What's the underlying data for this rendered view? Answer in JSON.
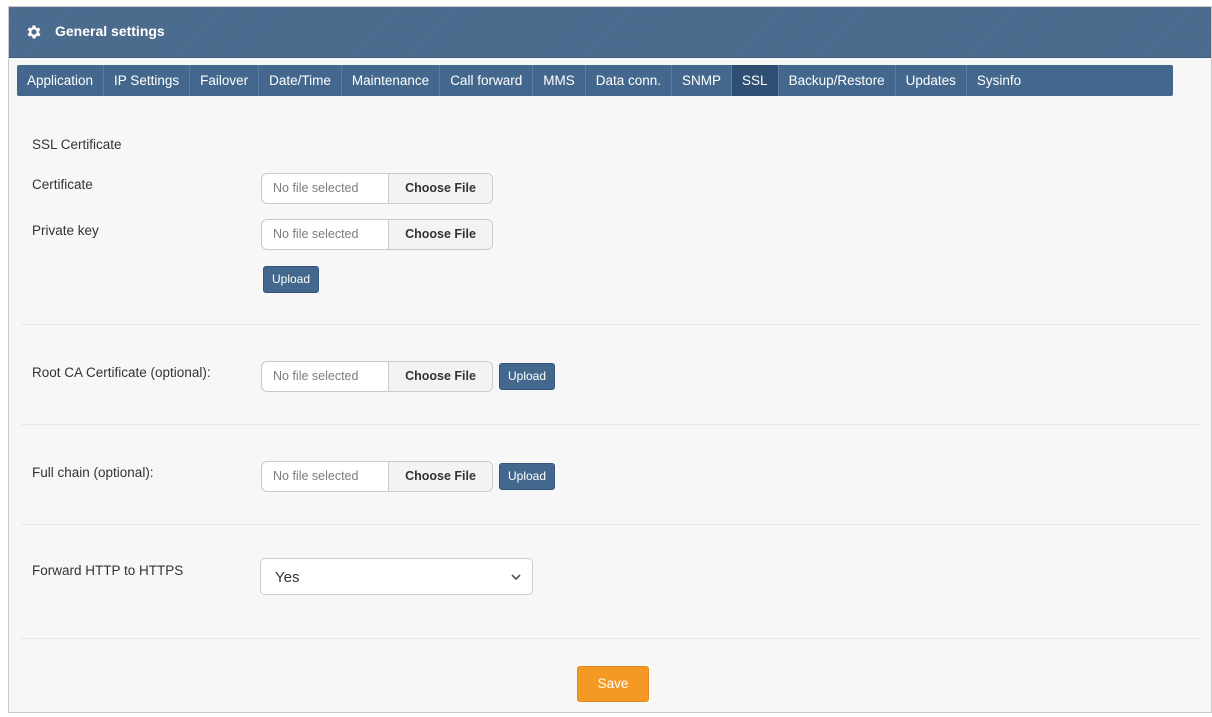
{
  "header": {
    "title": "General settings",
    "icon": "gear-icon"
  },
  "tabs": [
    {
      "label": "Application"
    },
    {
      "label": "IP Settings"
    },
    {
      "label": "Failover"
    },
    {
      "label": "Date/Time"
    },
    {
      "label": "Maintenance"
    },
    {
      "label": "Call forward"
    },
    {
      "label": "MMS"
    },
    {
      "label": "Data conn."
    },
    {
      "label": "SNMP"
    },
    {
      "label": "SSL",
      "active": true
    },
    {
      "label": "Backup/Restore"
    },
    {
      "label": "Updates"
    },
    {
      "label": "Sysinfo"
    }
  ],
  "ssl": {
    "section_title": "SSL Certificate",
    "certificate": {
      "label": "Certificate",
      "status": "No file selected",
      "button": "Choose File"
    },
    "private_key": {
      "label": "Private key",
      "status": "No file selected",
      "button": "Choose File"
    },
    "upload_label": "Upload"
  },
  "root_ca": {
    "label": "Root CA Certificate (optional):",
    "status": "No file selected",
    "button": "Choose File",
    "upload_label": "Upload"
  },
  "full_chain": {
    "label": "Full chain (optional):",
    "status": "No file selected",
    "button": "Choose File",
    "upload_label": "Upload"
  },
  "forward_http": {
    "label": "Forward HTTP to HTTPS",
    "value": "Yes"
  },
  "save_label": "Save",
  "colors": {
    "header": "#4a6a8c",
    "tab_bar": "#44688d",
    "tab_active": "#2e4f72",
    "upload_button": "#44688d",
    "save_button": "#f49a24"
  }
}
